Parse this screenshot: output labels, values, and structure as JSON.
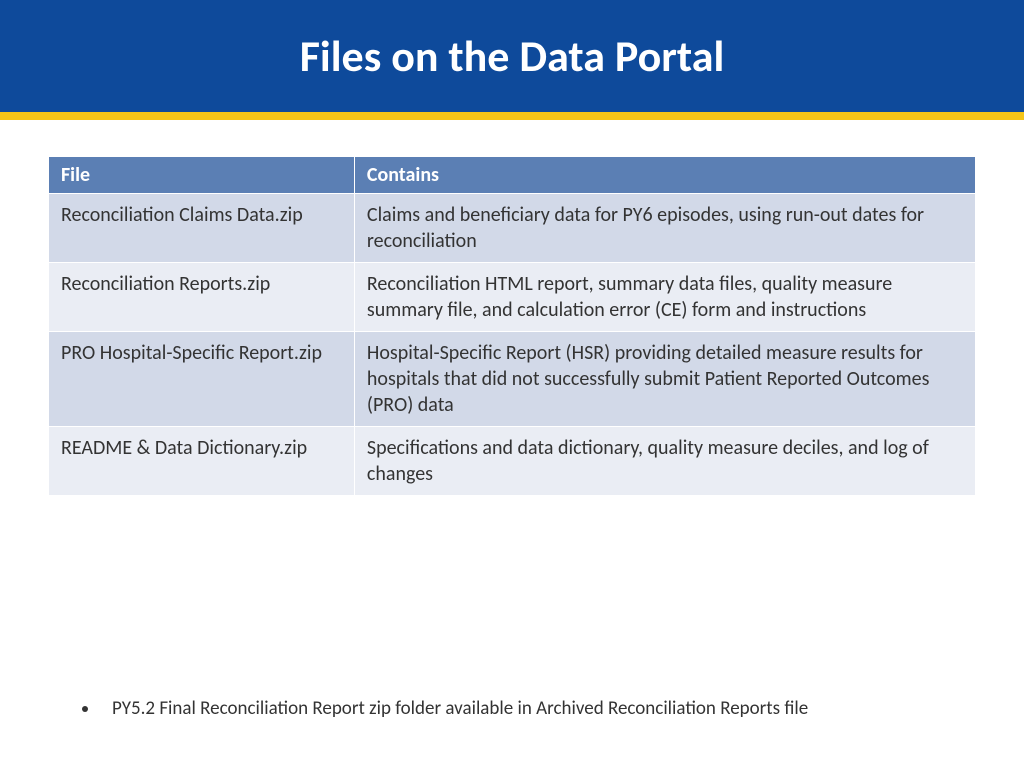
{
  "title": "Files on the Data Portal",
  "table": {
    "headers": {
      "file": "File",
      "contains": "Contains"
    },
    "rows": [
      {
        "file": "Reconciliation Claims Data.zip",
        "contains": "Claims and beneficiary data for PY6 episodes, using run-out dates for reconciliation"
      },
      {
        "file": "Reconciliation Reports.zip",
        "contains": "Reconciliation HTML report, summary data files, quality measure summary file, and calculation error (CE) form and instructions"
      },
      {
        "file": "PRO Hospital-Specific Report.zip",
        "contains": "Hospital-Specific Report (HSR) providing detailed measure results for hospitals that did not successfully submit Patient Reported Outcomes (PRO) data"
      },
      {
        "file": "README & Data Dictionary.zip",
        "contains": "Specifications and data dictionary, quality measure deciles, and log of changes"
      }
    ]
  },
  "bullets": [
    "PY5.2 Final Reconciliation Report zip folder available in Archived Reconciliation Reports file"
  ]
}
